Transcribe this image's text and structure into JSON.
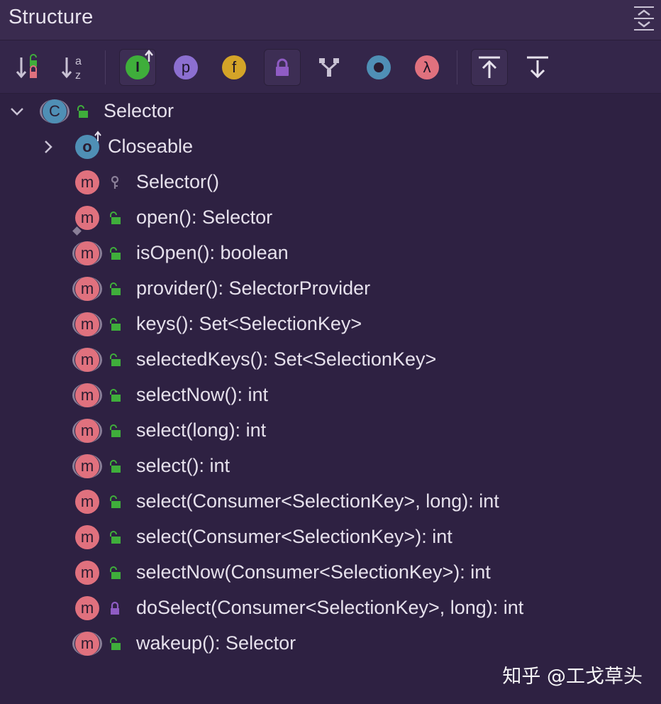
{
  "window": {
    "title": "Structure"
  },
  "toolbar": {
    "buttons": [
      {
        "name": "sort-by-visibility",
        "icon": "sort-visibility-icon"
      },
      {
        "name": "sort-alphabetically",
        "icon": "sort-az-icon",
        "glyph_a": "a",
        "glyph_z": "z"
      },
      {
        "name": "show-inherited",
        "icon": "interface-inherited-icon",
        "glyph": "I",
        "color": "#3fae3b",
        "active": true
      },
      {
        "name": "show-properties",
        "icon": "property-icon",
        "glyph": "p",
        "color": "#8c6fd1"
      },
      {
        "name": "show-fields",
        "icon": "field-icon",
        "glyph": "f",
        "color": "#d4a428"
      },
      {
        "name": "show-non-public",
        "icon": "lock-icon",
        "color": "#8f5cc4",
        "active": true
      },
      {
        "name": "show-anonymous",
        "icon": "anonymous-branch-icon"
      },
      {
        "name": "show-lambdas-circle",
        "icon": "circle-icon",
        "color": "#4f8fb5"
      },
      {
        "name": "show-lambdas",
        "icon": "lambda-icon",
        "glyph": "λ",
        "color": "#e0717e"
      },
      {
        "name": "autoscroll-to-source",
        "icon": "scroll-to-source-icon",
        "active": true
      },
      {
        "name": "autoscroll-from-source",
        "icon": "scroll-from-source-icon"
      }
    ]
  },
  "tree": {
    "root": {
      "label": "Selector",
      "icon_glyph": "C",
      "icon": "class-icon",
      "expanded": true
    },
    "closeable": {
      "label": "Closeable",
      "icon_glyph": "o",
      "icon": "interface-icon",
      "expanded": false
    },
    "members": [
      {
        "label": "Selector()",
        "access": "package",
        "abstract": false
      },
      {
        "label": "open(): Selector",
        "access": "public",
        "abstract": false,
        "static": true
      },
      {
        "label": "isOpen(): boolean",
        "access": "public",
        "abstract": true
      },
      {
        "label": "provider(): SelectorProvider",
        "access": "public",
        "abstract": true
      },
      {
        "label": "keys(): Set<SelectionKey>",
        "access": "public",
        "abstract": true
      },
      {
        "label": "selectedKeys(): Set<SelectionKey>",
        "access": "public",
        "abstract": true
      },
      {
        "label": "selectNow(): int",
        "access": "public",
        "abstract": true
      },
      {
        "label": "select(long): int",
        "access": "public",
        "abstract": true
      },
      {
        "label": "select(): int",
        "access": "public",
        "abstract": true
      },
      {
        "label": "select(Consumer<SelectionKey>, long): int",
        "access": "public",
        "abstract": false
      },
      {
        "label": "select(Consumer<SelectionKey>): int",
        "access": "public",
        "abstract": false
      },
      {
        "label": "selectNow(Consumer<SelectionKey>): int",
        "access": "public",
        "abstract": false
      },
      {
        "label": "doSelect(Consumer<SelectionKey>, long): int",
        "access": "private",
        "abstract": false
      },
      {
        "label": "wakeup(): Selector",
        "access": "public",
        "abstract": true
      }
    ],
    "method_glyph": "m"
  },
  "watermark": "知乎 @工戈草头",
  "colors": {
    "background": "#2e2142",
    "method": "#e0717e",
    "public_lock": "#3fae3b",
    "private_lock": "#8f5cc4",
    "class_icon": "#4f8fb5"
  }
}
